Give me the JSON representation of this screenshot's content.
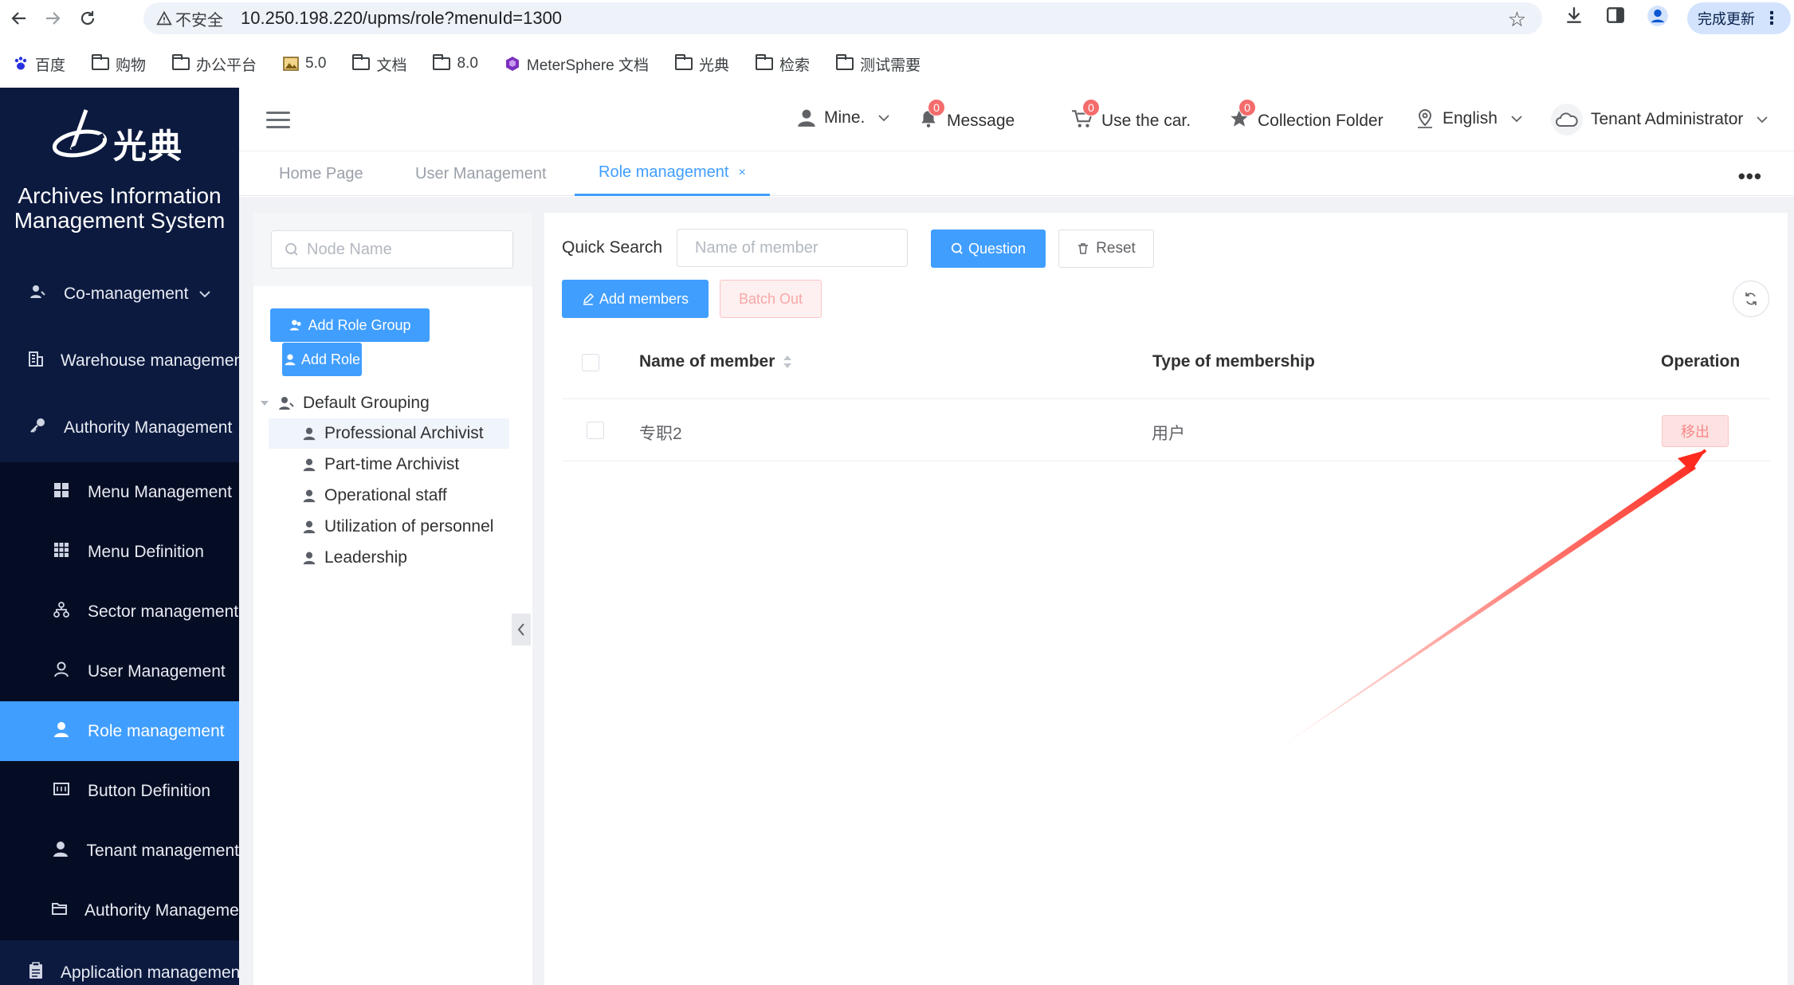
{
  "browser": {
    "insecure_label": "不安全",
    "url": "10.250.198.220/upms/role?menuId=1300",
    "update_label": "完成更新"
  },
  "bookmarks": [
    {
      "label": "百度",
      "icon": "baidu-paw"
    },
    {
      "label": "购物",
      "icon": "folder"
    },
    {
      "label": "办公平台",
      "icon": "folder"
    },
    {
      "label": "5.0",
      "icon": "image"
    },
    {
      "label": "文档",
      "icon": "folder"
    },
    {
      "label": "8.0",
      "icon": "folder"
    },
    {
      "label": "MeterSphere 文档",
      "icon": "metersphere"
    },
    {
      "label": "光典",
      "icon": "folder"
    },
    {
      "label": "检索",
      "icon": "folder"
    },
    {
      "label": "测试需要",
      "icon": "folder"
    }
  ],
  "sidebar": {
    "logo_text": "光典",
    "system_title_line1": "Archives Information",
    "system_title_line2": "Management System",
    "items": [
      {
        "label": "Co-management"
      },
      {
        "label": "Warehouse management"
      },
      {
        "label": "Authority Management"
      },
      {
        "label": "Menu Management"
      },
      {
        "label": "Menu Definition"
      },
      {
        "label": "Sector management"
      },
      {
        "label": "User Management"
      },
      {
        "label": "Role management"
      },
      {
        "label": "Button Definition"
      },
      {
        "label": "Tenant management"
      },
      {
        "label": "Authority Management"
      },
      {
        "label": "Application management"
      }
    ]
  },
  "header": {
    "mine": "Mine.",
    "message": "Message",
    "message_count": "0",
    "car": "Use the car.",
    "car_count": "0",
    "collection": "Collection Folder",
    "collection_count": "0",
    "language": "English",
    "tenant": "Tenant Administrator"
  },
  "tabs": [
    {
      "label": "Home Page"
    },
    {
      "label": "User Management"
    },
    {
      "label": "Role management",
      "close": "×"
    }
  ],
  "tree": {
    "search_placeholder": "Node Name",
    "add_role_group": "Add Role Group",
    "add_role": "Add Role",
    "root": "Default Grouping",
    "children": [
      "Professional Archivist",
      "Part-time Archivist",
      "Operational staff",
      "Utilization of personnel",
      "Leadership"
    ]
  },
  "main": {
    "quick_search_label": "Quick Search",
    "member_placeholder": "Name of member",
    "question_btn": "Question",
    "reset_btn": "Reset",
    "add_members_btn": "Add members",
    "batch_out_btn": "Batch Out",
    "columns": [
      "Name of member",
      "Type of membership",
      "Operation"
    ],
    "rows": [
      {
        "name": "专职2",
        "type": "用户",
        "action": "移出"
      }
    ]
  },
  "colors": {
    "sidebar_bg": "#0c1a3f",
    "accent": "#409eff",
    "danger": "#f56c6c",
    "annotation_arrow": "#ff2a1f"
  }
}
